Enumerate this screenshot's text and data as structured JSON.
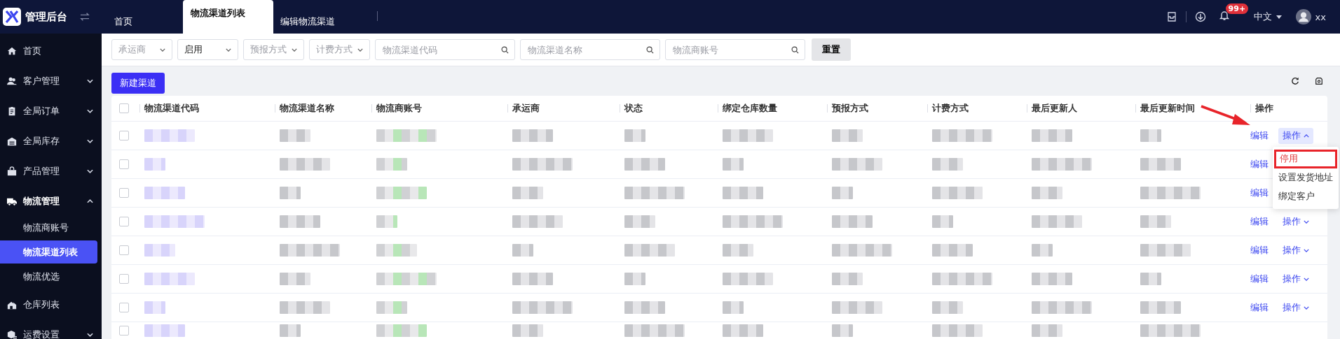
{
  "header": {
    "logo_text": "管理后台",
    "tabs": [
      {
        "label": "首页",
        "selected": false
      },
      {
        "label": "物流渠道列表",
        "selected": true
      },
      {
        "label": "编辑物流渠道",
        "selected": false
      }
    ],
    "badge": "99+",
    "language": "中文",
    "user": "xx"
  },
  "sidebar": {
    "items": [
      {
        "label": "首页",
        "expanded": false,
        "has_children": false
      },
      {
        "label": "客户管理",
        "expanded": false,
        "has_children": true
      },
      {
        "label": "全局订单",
        "expanded": false,
        "has_children": true
      },
      {
        "label": "全局库存",
        "expanded": false,
        "has_children": true
      },
      {
        "label": "产品管理",
        "expanded": false,
        "has_children": true
      },
      {
        "label": "物流管理",
        "expanded": true,
        "has_children": true,
        "children": [
          {
            "label": "物流商账号",
            "selected": false
          },
          {
            "label": "物流渠道列表",
            "selected": true
          },
          {
            "label": "物流优选",
            "selected": false
          }
        ]
      },
      {
        "label": "仓库列表",
        "expanded": false,
        "has_children": false
      },
      {
        "label": "运费设置",
        "expanded": false,
        "has_children": true
      }
    ]
  },
  "filters": [
    {
      "kind": "select",
      "placeholder": "承运商"
    },
    {
      "kind": "select",
      "value": "启用"
    },
    {
      "kind": "select",
      "placeholder": "预报方式"
    },
    {
      "kind": "select",
      "placeholder": "计费方式"
    },
    {
      "kind": "search",
      "placeholder": "物流渠道代码"
    },
    {
      "kind": "search",
      "placeholder": "物流渠道名称"
    },
    {
      "kind": "search",
      "placeholder": "物流商账号"
    }
  ],
  "reset_button": "重置",
  "new_button": "新建渠道",
  "table": {
    "columns": [
      "物流渠道代码",
      "物流渠道名称",
      "物流商账号",
      "承运商",
      "状态",
      "绑定仓库数量",
      "预报方式",
      "计费方式",
      "最后更新人",
      "最后更新时间",
      "操作"
    ],
    "all_checked": false,
    "rows": [
      {
        "kind": "full",
        "checked": false,
        "edit": "编辑",
        "more": "操作",
        "expanded": true
      },
      {
        "kind": "full",
        "checked": false,
        "edit": "编辑"
      },
      {
        "kind": "full",
        "checked": false,
        "edit": "编辑"
      },
      {
        "kind": "full",
        "checked": false,
        "edit": "编辑",
        "more": "操作",
        "expanded": false
      },
      {
        "kind": "full",
        "checked": false,
        "edit": "编辑",
        "more": "操作",
        "expanded": false
      },
      {
        "kind": "full",
        "checked": false,
        "edit": "编辑",
        "more": "操作",
        "expanded": false
      },
      {
        "kind": "full",
        "checked": false,
        "edit": "编辑",
        "more": "操作",
        "expanded": false
      },
      {
        "kind": "cut",
        "checked": false
      }
    ]
  },
  "action_menu": {
    "items": [
      {
        "label": "停用",
        "selected": true
      },
      {
        "label": "设置发货地址",
        "selected": false
      },
      {
        "label": "绑定客户",
        "selected": false
      }
    ]
  }
}
